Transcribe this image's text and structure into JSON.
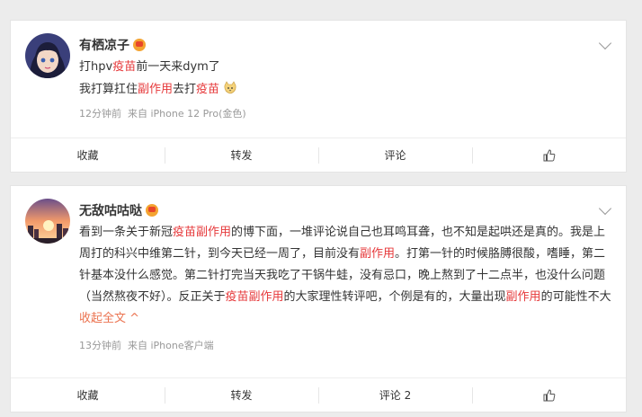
{
  "posts": [
    {
      "username": "有栖凉子",
      "line1": [
        "打hpv",
        "疫苗",
        "前一天来dym了"
      ],
      "line2": [
        "我打算扛住",
        "副作用",
        "去打",
        "疫苗"
      ],
      "time": "12分钟前",
      "source": "来自 iPhone 12 Pro(金色)",
      "actions": {
        "favorite": "收藏",
        "repost": "转发",
        "comment": "评论"
      }
    },
    {
      "username": "无敌咕咕哒",
      "text": [
        "看到一条关于新冠",
        "疫苗副作用",
        "的博下面，一堆评论说自己也耳鸣耳聋，也不知是起哄还是真的。我是上周打的科兴中维第二针，到今天已经一周了，目前没有",
        "副作用",
        "。打第一针的时候胳膊很酸，嗜睡，第二针基本没什么感觉。第二针打完当天我吃了干锅牛蛙，没有忌口，晚上熬到了十二点半，也没什么问题（当然熬夜不好）。反正关于",
        "疫苗副作用",
        "的大家理性转评吧，个例是有的，大量出现",
        "副作用",
        "的可能性不大 "
      ],
      "expand": "收起全文",
      "time": "13分钟前",
      "source": "来自 iPhone客户端",
      "actions": {
        "favorite": "收藏",
        "repost": "转发",
        "comment": "评论 2"
      }
    }
  ],
  "icons": {
    "vip": "vip-crown-icon",
    "more": "chevron-down-icon",
    "like": "thumbs-up-icon",
    "emoji": "cat-emoji-icon"
  }
}
